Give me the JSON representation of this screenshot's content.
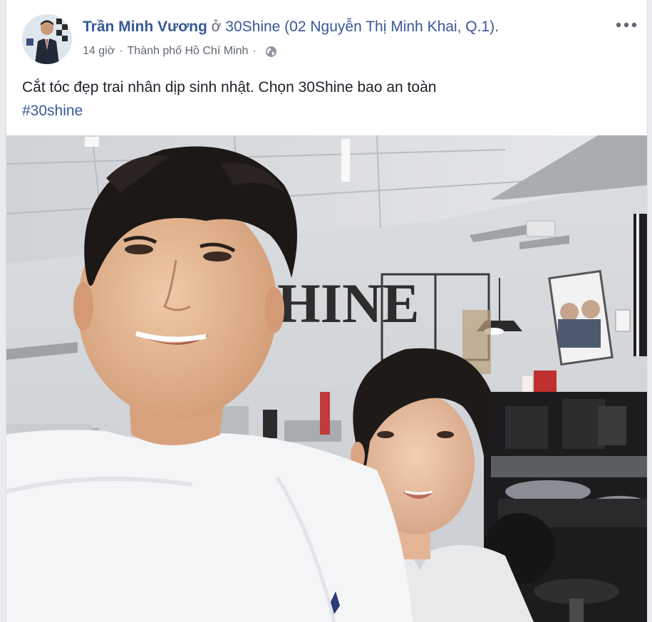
{
  "post": {
    "author": "Trần Minh Vương",
    "at_word": "ở",
    "place": "30Shine (02 Nguyễn Thị Minh Khai, Q.1).",
    "time": "14 giờ",
    "location": "Thành phố Hồ Chí Minh",
    "separator": "·",
    "text": "Cắt tóc đẹp trai nhân dịp sinh nhật. Chọn 30Shine bao an toàn",
    "hashtag": "#30shine",
    "privacy_icon": "globe-icon",
    "more_icon": "more-options-icon",
    "photo_sign_text": "HINE"
  },
  "colors": {
    "link": "#385898",
    "text": "#1d2129",
    "meta": "#616770",
    "background": "#e9ebee",
    "card": "#ffffff"
  }
}
